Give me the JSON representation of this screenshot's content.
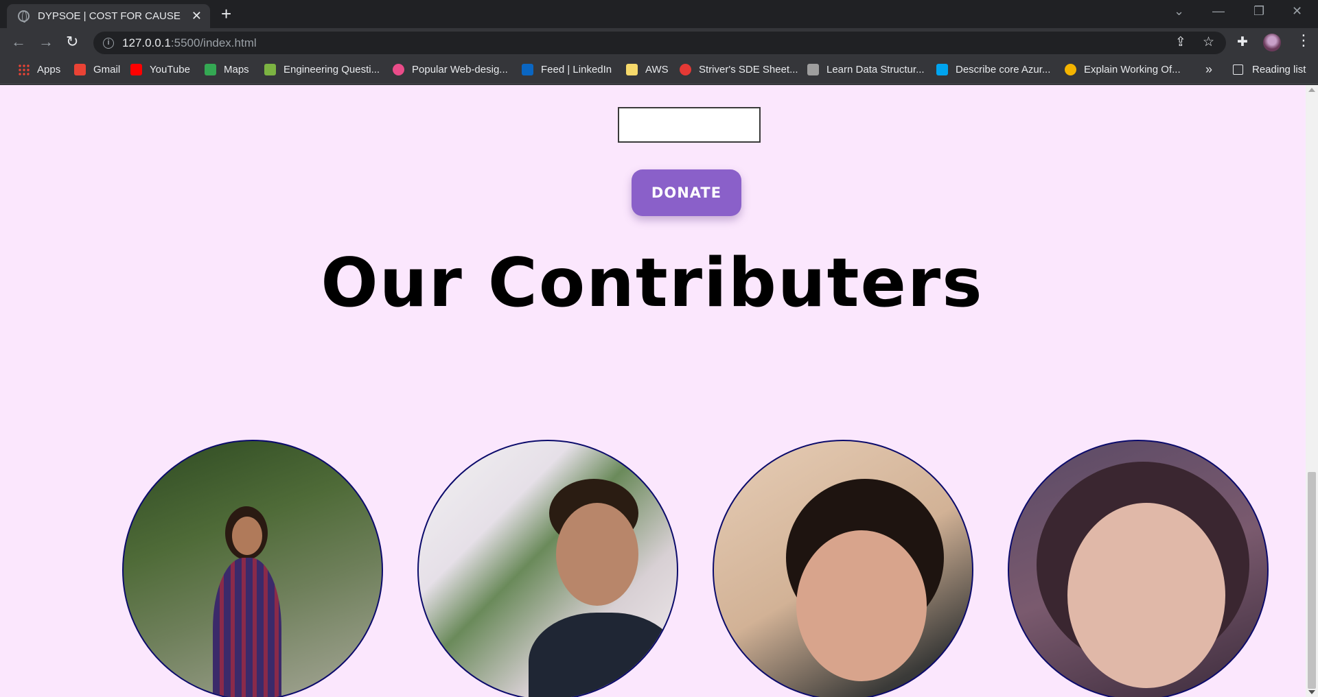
{
  "browser": {
    "tab_title": "DYPSOE | COST FOR CAUSE",
    "tab_close": "✕",
    "new_tab": "+",
    "url_host": "127.0.0.1",
    "url_path": ":5500/index.html",
    "bookmarks": [
      {
        "label": "Apps",
        "icon": "apps-grid-icon",
        "color": "#4285f4"
      },
      {
        "label": "Gmail",
        "icon": "gmail-icon",
        "color": "#ea4335"
      },
      {
        "label": "YouTube",
        "icon": "youtube-icon",
        "color": "#ff0000"
      },
      {
        "label": "Maps",
        "icon": "maps-icon",
        "color": "#34a853"
      },
      {
        "label": "Engineering Questi...",
        "icon": "leaf-icon",
        "color": "#7cb342"
      },
      {
        "label": "Popular Web-desig...",
        "icon": "dribbble-icon",
        "color": "#ea4c89"
      },
      {
        "label": "Feed | LinkedIn",
        "icon": "linkedin-icon",
        "color": "#0a66c2"
      },
      {
        "label": "AWS",
        "icon": "folder-icon",
        "color": "#f6d96b"
      },
      {
        "label": "Striver's SDE Sheet...",
        "icon": "tuf-icon",
        "color": "#e53935"
      },
      {
        "label": "Learn Data Structur...",
        "icon": "cc-icon",
        "color": "#9e9e9e"
      },
      {
        "label": "Describe core Azur...",
        "icon": "microsoft-icon",
        "color": "#00a4ef"
      },
      {
        "label": "Explain Working Of...",
        "icon": "refresh-orange-icon",
        "color": "#f4b400"
      }
    ],
    "more_bookmarks": "»",
    "reading_list": "Reading list"
  },
  "page": {
    "donate_label": "DONATE",
    "amount_value": "",
    "section_title": "Our Contributers",
    "background": "#fbe7fd",
    "accent": "#8a60c9",
    "contributors": [
      {
        "photo": "contributor-1-photo"
      },
      {
        "photo": "contributor-2-photo"
      },
      {
        "photo": "contributor-3-photo"
      },
      {
        "photo": "contributor-4-photo"
      }
    ]
  }
}
